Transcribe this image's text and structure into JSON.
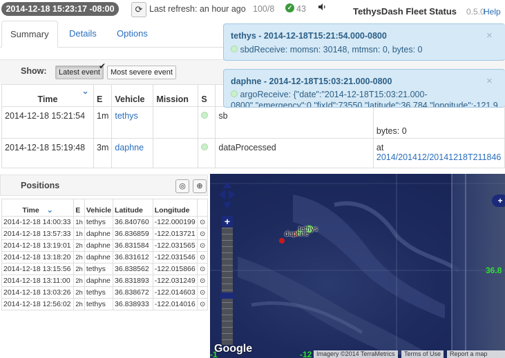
{
  "header": {
    "clock": "2014-12-18 15:23:17 -08:00",
    "refresh_icon": "refresh-icon",
    "last_refresh": "Last refresh: an hour ago",
    "counter": "100/8",
    "ok_icon": "check-circle-icon",
    "ok_count": "43",
    "sound_icon": "speaker-icon",
    "app_title": "TethysDash Fleet Status",
    "version": "0.5.0",
    "help": "Help"
  },
  "tabs": [
    "Summary",
    "Details",
    "Options"
  ],
  "show": {
    "label": "Show:",
    "latest": "Latest event",
    "severe": "Most severe event"
  },
  "events": {
    "headers": [
      "Time",
      "E",
      "Vehicle",
      "Mission",
      "S"
    ],
    "rows": [
      {
        "time": "2014-12-18 15:21:54",
        "e": "1m",
        "vehicle": "tethys",
        "event": "sb",
        "right": "bytes: 0",
        "link": ""
      },
      {
        "time": "2014-12-18 15:19:48",
        "e": "3m",
        "vehicle": "daphne",
        "event": "dataProcessed",
        "right": "at",
        "link": "2014/201412/20141218T211846"
      }
    ]
  },
  "popovers": [
    {
      "title": "tethys - 2014-12-18T15:21:54.000-0800",
      "body": "sbdReceive: momsn: 30148, mtmsn: 0, bytes: 0"
    },
    {
      "title": "daphne - 2014-12-18T15:03:21.000-0800",
      "body": "argoReceive: {\"date\":\"2014-12-18T15:03:21.000-0800\",\"emergency\":0,\"fixId\":73550,\"latitude\":36.784,\"longitude\":-121.9"
    }
  ],
  "positions": {
    "title": "Positions",
    "headers": [
      "Time",
      "E",
      "Vehicle",
      "Latitude",
      "Longitude"
    ],
    "rows": [
      [
        "2014-12-18 14:00:33",
        "1h",
        "tethys",
        "36.840760",
        "-122.000199"
      ],
      [
        "2014-12-18 13:57:33",
        "1h",
        "daphne",
        "36.836859",
        "-122.013721"
      ],
      [
        "2014-12-18 13:19:01",
        "2h",
        "daphne",
        "36.831584",
        "-122.031565"
      ],
      [
        "2014-12-18 13:18:20",
        "2h",
        "daphne",
        "36.831612",
        "-122.031546"
      ],
      [
        "2014-12-18 13:15:56",
        "2h",
        "tethys",
        "36.838562",
        "-122.015866"
      ],
      [
        "2014-12-18 13:11:00",
        "2h",
        "daphne",
        "36.831893",
        "-122.031249"
      ],
      [
        "2014-12-18 13:03:26",
        "2h",
        "tethys",
        "36.838672",
        "-122.014603"
      ],
      [
        "2014-12-18 12:56:02",
        "2h",
        "tethys",
        "36.838933",
        "-122.014016"
      ]
    ]
  },
  "map": {
    "marker_tethys": "tethys",
    "marker_daphne": "daphne",
    "lat_label": "36.8",
    "bottom_label": "-12",
    "google": "Google",
    "imagery": "Imagery ©2014 TerraMetrics",
    "terms": "Terms of Use",
    "report": "Report a map error"
  }
}
